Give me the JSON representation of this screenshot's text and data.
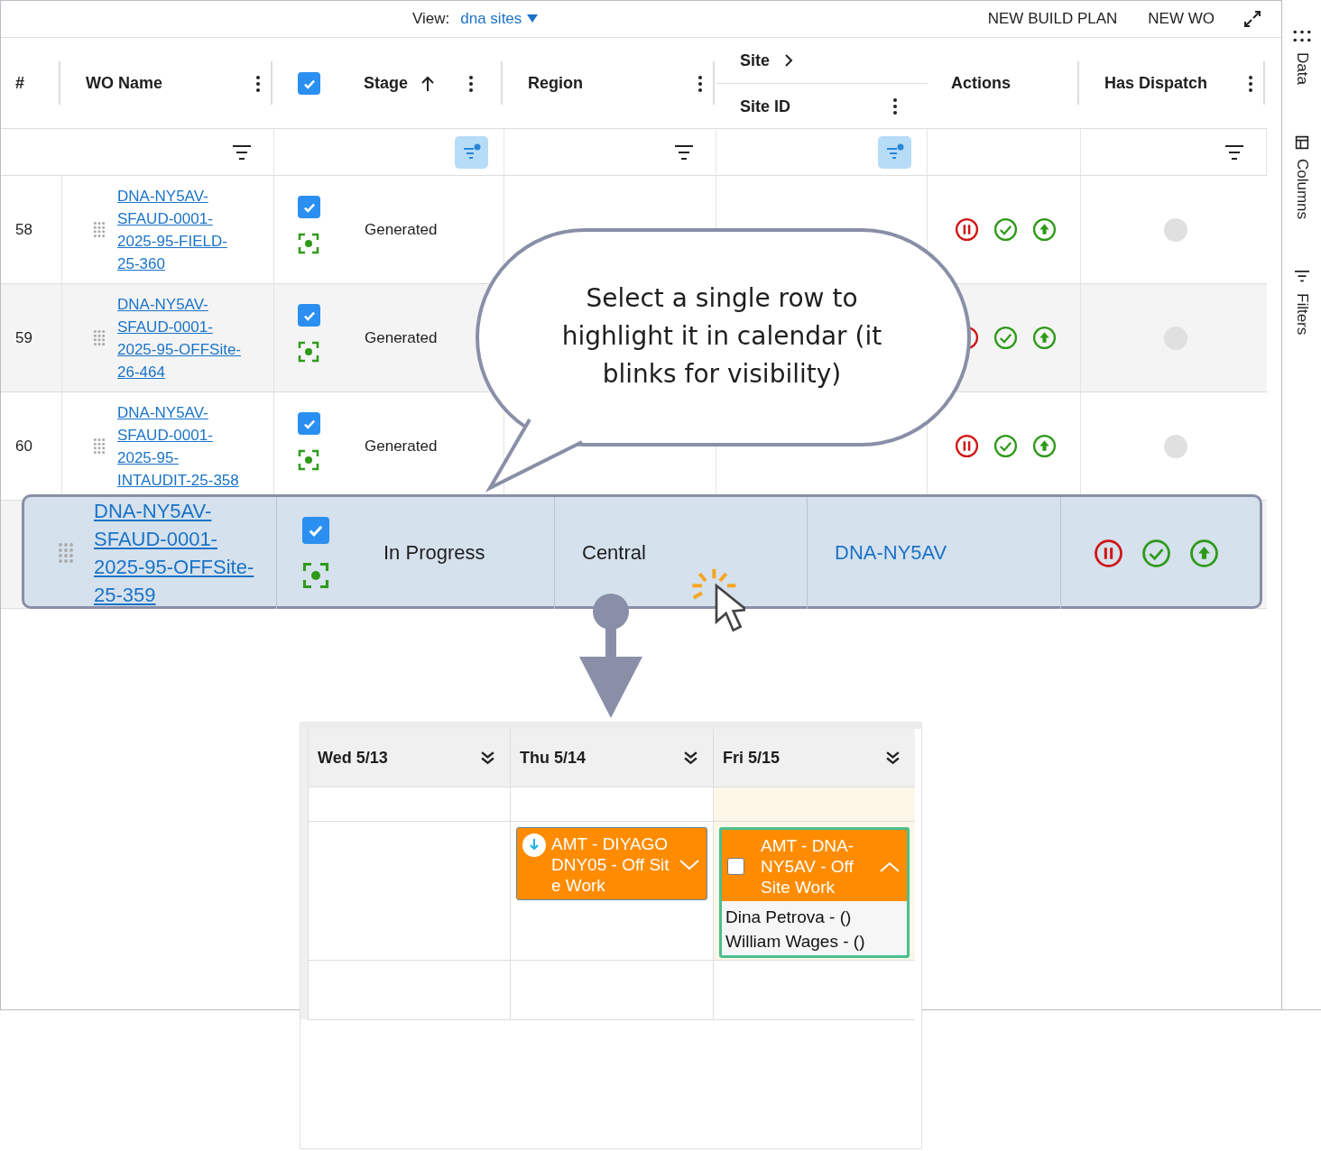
{
  "toolbar": {
    "view_label": "View:",
    "view_value": "dna sites",
    "buttons": [
      "NEW BUILD PLAN",
      "NEW WO"
    ]
  },
  "side_panel": {
    "tabs": [
      "Data",
      "Columns",
      "Filters"
    ]
  },
  "table": {
    "select_all": true,
    "columns": [
      {
        "label": "#"
      },
      {
        "label": "WO Name",
        "filter_active": false
      },
      {
        "label": "Stage",
        "sorted_ascending": true,
        "filter_active": true
      },
      {
        "label": "Region",
        "filter_active": false
      },
      {
        "label": "Site",
        "sub_label": "Site ID",
        "filter_active": true
      },
      {
        "label": "Actions"
      },
      {
        "label": "Has Dispatch",
        "filter_active": false
      }
    ],
    "rows": [
      {
        "number": "58",
        "wo_name": "DNA-NY5AV-SFAUD-0001-2025-95-FIELD-25-360",
        "checked": true,
        "stage": "Generated",
        "selected": false
      },
      {
        "number": "59",
        "wo_name": "DNA-NY5AV-SFAUD-0001-2025-95-OFFSite-26-464",
        "checked": true,
        "stage": "Generated",
        "selected": false
      },
      {
        "number": "60",
        "wo_name": "DNA-NY5AV-SFAUD-0001-2025-95-INTAUDIT-25-358",
        "checked": true,
        "stage": "Generated",
        "selected": false
      },
      {
        "wo_name": "DNA-NY5AV-SFAUD-0001-2025-95-OFFSite-25-359",
        "checked": true,
        "stage": "In Progress",
        "region": "Central",
        "site": "DNA-NY5AV",
        "selected": true
      }
    ]
  },
  "callout": {
    "text": "Select a single row to highlight it in calendar (it blinks for visibility)"
  },
  "calendar": {
    "days": [
      {
        "label": "Wed 5/13",
        "today": false
      },
      {
        "label": "Thu 5/14",
        "today": false,
        "events": [
          {
            "kind": "download",
            "title": "AMT - DIYAGODNY05 - Off Site Work",
            "expanded": false,
            "selected": false
          }
        ]
      },
      {
        "label": "Fri 5/15",
        "today": true,
        "events": [
          {
            "kind": "checkbox",
            "checked": false,
            "title": "AMT - DNA-NY5AV - Off Site Work",
            "expanded": true,
            "selected": true,
            "assignees": [
              "Dina Petrova - ()",
              "William Wages - ()"
            ]
          }
        ]
      }
    ]
  }
}
